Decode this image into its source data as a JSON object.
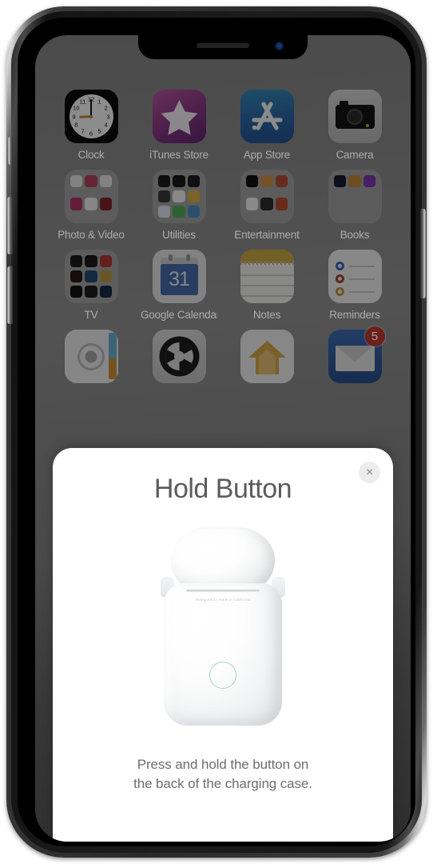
{
  "device": {
    "name": "iPhone X",
    "notch_camera_icon": "front-camera-icon",
    "notch_speaker_icon": "earpiece-speaker-icon",
    "buttons": [
      {
        "name": "silent-switch",
        "label": "Silent switch"
      },
      {
        "name": "volume-up-button",
        "label": "Volume up"
      },
      {
        "name": "volume-down-button",
        "label": "Volume down"
      },
      {
        "name": "side-power-button",
        "label": "Side button"
      }
    ]
  },
  "homescreen": {
    "rows": [
      {
        "apps": [
          {
            "label": "Clock",
            "icon": "clock-icon",
            "type": "app"
          },
          {
            "label": "iTunes Store",
            "icon": "itunes-store-icon",
            "type": "app"
          },
          {
            "label": "App Store",
            "icon": "app-store-icon",
            "type": "app"
          },
          {
            "label": "Camera",
            "icon": "camera-icon",
            "type": "app"
          }
        ]
      },
      {
        "apps": [
          {
            "label": "Photo & Video",
            "icon": "folder-icon",
            "type": "folder",
            "minis": [
              "#e8e8e8",
              "#d43a63",
              "#e8e8e8",
              "#d5286a",
              "#f0f0f0",
              "#9b1c24"
            ]
          },
          {
            "label": "Utilities",
            "icon": "folder-icon",
            "type": "folder",
            "minis": [
              "#1a1a1a",
              "#181818",
              "#1c1c1c",
              "#3a3a3a",
              "#f2f2f2",
              "#e8b52a",
              "#dfe9f5",
              "#3bb54a",
              "#3a93d8"
            ]
          },
          {
            "label": "Entertainment",
            "icon": "folder-icon",
            "type": "folder",
            "minis": [
              "#101010",
              "#e09130",
              "#d8452a",
              "#f4f4f4",
              "#2a2a2a",
              "#d8481f"
            ]
          },
          {
            "label": "Books",
            "icon": "folder-icon",
            "type": "folder",
            "minis": [
              "#141d3a",
              "#d4871e",
              "#8f2fcf"
            ]
          }
        ]
      },
      {
        "apps": [
          {
            "label": "TV",
            "icon": "folder-icon",
            "type": "folder",
            "minis": [
              "#1a1a1a",
              "#1a1a1a",
              "#d32f2f",
              "#2a1515",
              "#1c4a80",
              "#c99a22",
              "#101010",
              "#1a1a1a",
              "#0f2a52"
            ]
          },
          {
            "label": "Google Calendar",
            "icon": "google-calendar-icon",
            "type": "app",
            "day": "31"
          },
          {
            "label": "Notes",
            "icon": "notes-icon",
            "type": "app"
          },
          {
            "label": "Reminders",
            "icon": "reminders-icon",
            "type": "app"
          }
        ]
      },
      {
        "apps": [
          {
            "label": "",
            "icon": "voice-memos-icon",
            "type": "app"
          },
          {
            "label": "",
            "icon": "settings-gear-icon",
            "type": "app"
          },
          {
            "label": "",
            "icon": "home-icon",
            "type": "app"
          },
          {
            "label": "",
            "icon": "mail-icon",
            "type": "app",
            "badge": "5"
          }
        ]
      }
    ]
  },
  "modal": {
    "title": "Hold Button",
    "close_label": "×",
    "close_icon": "close-icon",
    "caption_line1": "Press and hold the button on",
    "caption_line2": "the back of the charging case.",
    "illustration": {
      "name": "airpods-charging-case",
      "engraving": "Designed by Apple in California",
      "setup_button_icon": "setup-button-icon"
    }
  },
  "colors": {
    "dimmed_wallpaper": "#4d4d4d",
    "sheet_background": "#ffffff",
    "title_text": "#5c5c5c",
    "caption_text": "#6e6e6e",
    "close_button_bg": "#ececec",
    "badge_red": "#c62d23",
    "setup_ring_green": "#a8d9b8"
  }
}
